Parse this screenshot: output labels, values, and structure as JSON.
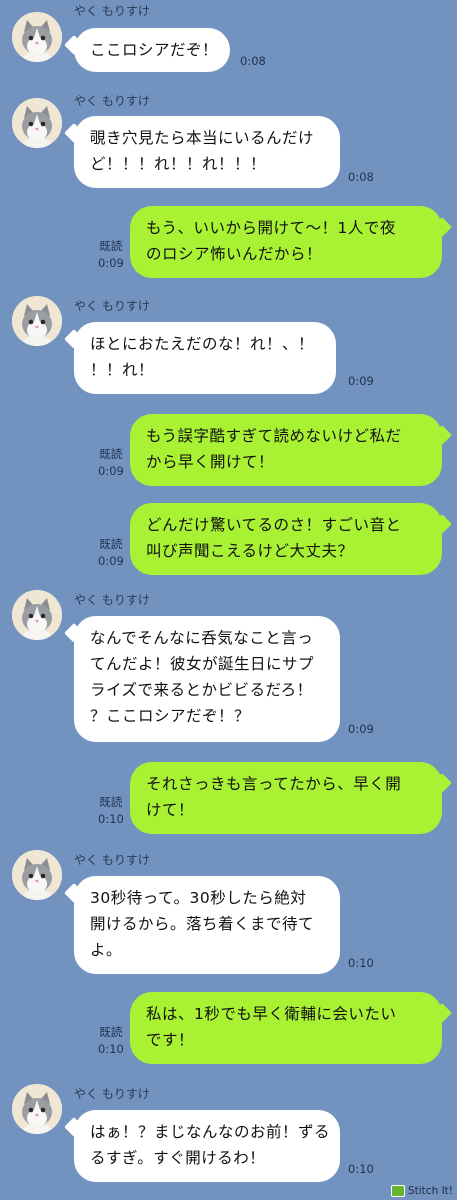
{
  "colors": {
    "background": "#7293c0",
    "incoming_bubble": "#ffffff",
    "outgoing_bubble": "#a9f133"
  },
  "messages": [
    {
      "sender": "やく もりすけ",
      "lines": [
        "ここロシアだぞ！"
      ],
      "time": "0:08"
    },
    {
      "sender": "やく もりすけ",
      "lines": [
        "覗き穴見たら本当にいるんだけ",
        "ど！！！れ！！れ！！！"
      ],
      "time": "0:08"
    },
    {
      "read": "既読",
      "lines": [
        "もう、いいから開けて〜！1人で夜",
        "のロシア怖いんだから！"
      ],
      "time": "0:09"
    },
    {
      "sender": "やく もりすけ",
      "lines": [
        "ほとにおたえだのな！れ！、！",
        "！！れ！"
      ],
      "time": "0:09"
    },
    {
      "read": "既読",
      "lines": [
        "もう誤字酷すぎて読めないけど私だ",
        "から早く開けて！"
      ],
      "time": "0:09"
    },
    {
      "read": "既読",
      "lines": [
        "どんだけ驚いてるのさ！すごい音と",
        "叫び声聞こえるけど大丈夫？"
      ],
      "time": "0:09"
    },
    {
      "sender": "やく もりすけ",
      "lines": [
        "なんでそんなに呑気なこと言っ",
        "てんだよ！彼女が誕生日にサプ",
        "ライズで来るとかビビるだろ！",
        "？ここロシアだぞ！？"
      ],
      "time": "0:09"
    },
    {
      "read": "既読",
      "lines": [
        "それさっきも言ってたから、早く開",
        "けて！"
      ],
      "time": "0:10"
    },
    {
      "sender": "やく もりすけ",
      "lines": [
        "30秒待って。30秒したら絶対",
        "開けるから。落ち着くまで待て",
        "よ。"
      ],
      "time": "0:10"
    },
    {
      "read": "既読",
      "lines": [
        "私は、1秒でも早く衛輔に会いたい",
        "です！"
      ],
      "time": "0:10"
    },
    {
      "sender": "やく もりすけ",
      "lines": [
        "はぁ！？まじなんなのお前！ずる",
        "るすぎ。すぐ開けるわ！"
      ],
      "time": "0:10"
    }
  ],
  "watermark": "Stitch It!"
}
